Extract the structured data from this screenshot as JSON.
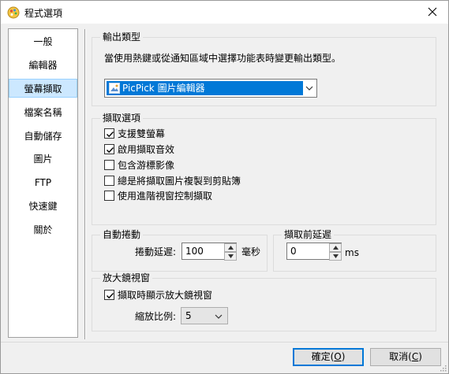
{
  "window": {
    "title": "程式選項"
  },
  "sidebar": {
    "items": [
      {
        "label": "一般"
      },
      {
        "label": "編輯器"
      },
      {
        "label": "螢幕擷取"
      },
      {
        "label": "檔案名稱"
      },
      {
        "label": "自動儲存"
      },
      {
        "label": "圖片"
      },
      {
        "label": "FTP"
      },
      {
        "label": "快速鍵"
      },
      {
        "label": "關於"
      }
    ],
    "selected": "螢幕擷取"
  },
  "output": {
    "legend": "輸出類型",
    "description": "當使用熱鍵或從通知區域中選擇功能表時變更輸出類型。",
    "selected": "PicPick 圖片編輯器"
  },
  "capture_options": {
    "legend": "擷取選項",
    "items": [
      {
        "label": "支援雙螢幕",
        "checked": true
      },
      {
        "label": "啟用擷取音效",
        "checked": true
      },
      {
        "label": "包含游標影像",
        "checked": false
      },
      {
        "label": "總是將擷取圖片複製到剪貼簿",
        "checked": false
      },
      {
        "label": "使用進階視窗控制擷取",
        "checked": false
      }
    ]
  },
  "auto_scroll": {
    "legend": "自動捲動",
    "delay_label": "捲動延遲:",
    "delay_value": "100",
    "unit": "毫秒"
  },
  "pre_capture_delay": {
    "legend": "擷取前延遲",
    "value": "0",
    "unit": "ms"
  },
  "magnifier": {
    "legend": "放大鏡視窗",
    "show_label": "擷取時顯示放大鏡視窗",
    "show_checked": true,
    "ratio_label": "縮放比例:",
    "ratio_value": "5"
  },
  "footer": {
    "ok_label": "確定",
    "ok_key": "O",
    "cancel_label": "取消",
    "cancel_key": "C"
  }
}
